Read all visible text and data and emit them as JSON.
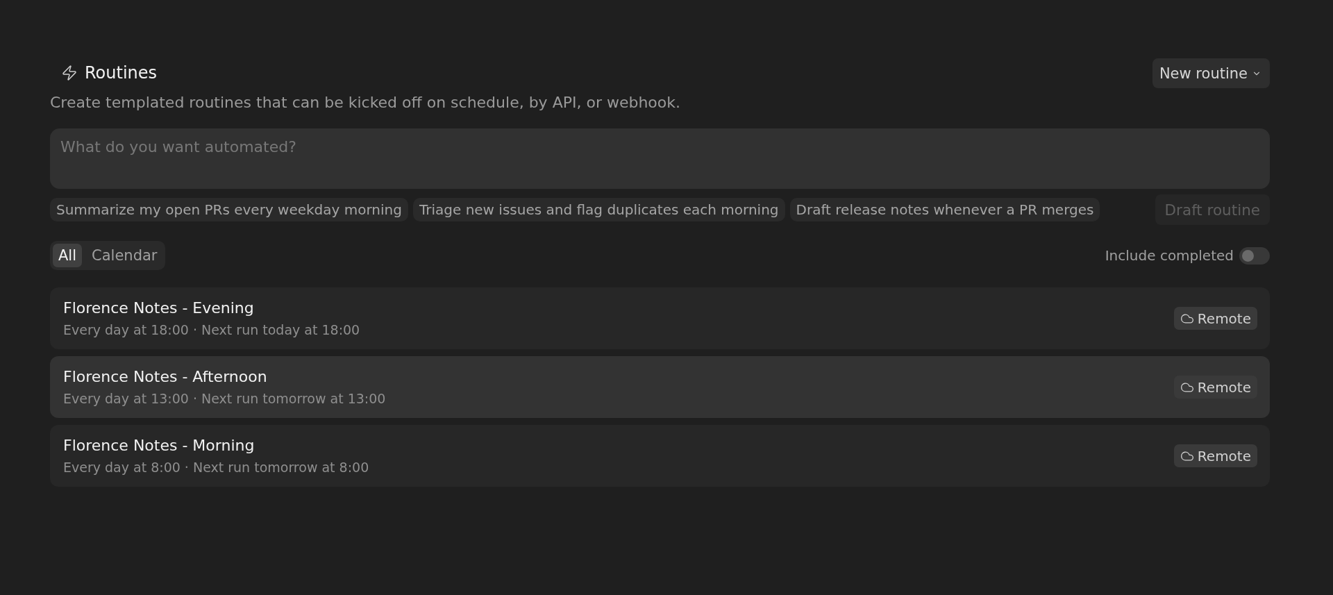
{
  "header": {
    "title": "Routines",
    "subtitle": "Create templated routines that can be kicked off on schedule, by API, or webhook.",
    "new_button": {
      "label": "New routine"
    }
  },
  "prompt": {
    "placeholder": "What do you want automated?"
  },
  "suggestions": [
    "Summarize my open PRs every weekday morning",
    "Triage new issues and flag duplicates each morning",
    "Draft release notes whenever a PR merges"
  ],
  "draft_button": {
    "label": "Draft routine",
    "disabled": true
  },
  "view_tabs": [
    {
      "label": "All",
      "selected": true
    },
    {
      "label": "Calendar",
      "selected": false
    }
  ],
  "include_completed": {
    "label": "Include completed",
    "on": false
  },
  "routines": [
    {
      "name": "Florence Notes - Evening",
      "schedule": "Every day at 18:00 · Next run today at 18:00",
      "highlighted": false,
      "location": "Remote"
    },
    {
      "name": "Florence Notes - Afternoon",
      "schedule": "Every day at 13:00 · Next run tomorrow at 13:00",
      "highlighted": true,
      "location": "Remote"
    },
    {
      "name": "Florence Notes - Morning",
      "schedule": "Every day at 8:00 · Next run tomorrow at 8:00",
      "highlighted": false,
      "location": "Remote"
    }
  ]
}
